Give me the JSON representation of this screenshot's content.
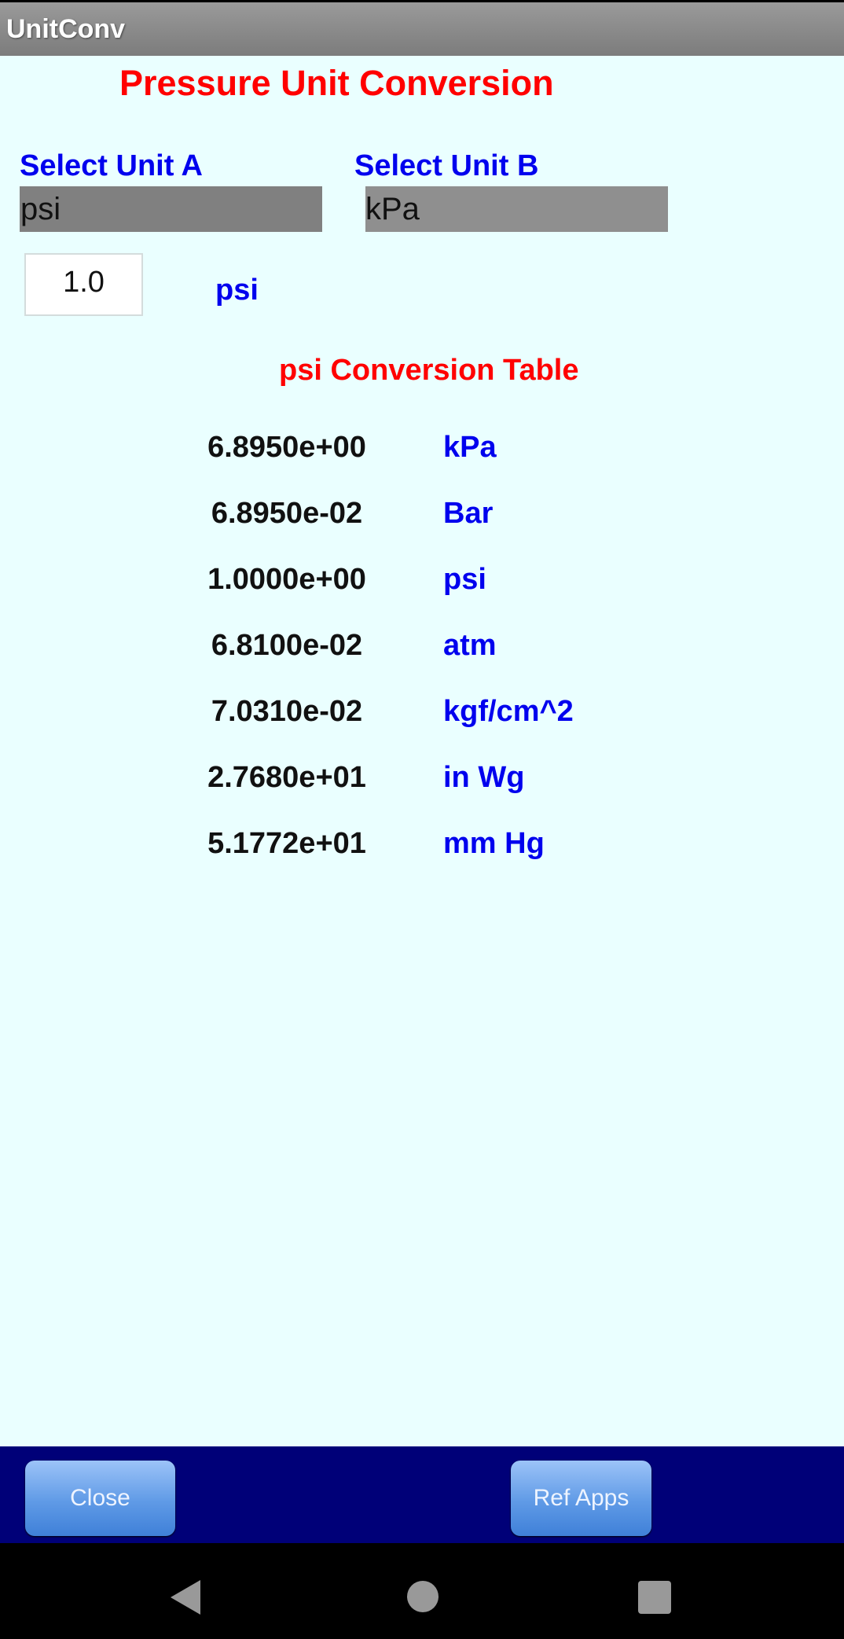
{
  "app": {
    "title": "UnitConv"
  },
  "page": {
    "heading": "Pressure Unit Conversion"
  },
  "unit_a": {
    "label": "Select Unit A",
    "selected": "psi"
  },
  "unit_b": {
    "label": "Select Unit B",
    "selected": "kPa"
  },
  "input": {
    "value": "1.0",
    "unit_label": "psi"
  },
  "table": {
    "title": "psi Conversion Table",
    "rows": [
      {
        "value": "6.8950e+00",
        "unit": "kPa"
      },
      {
        "value": "6.8950e-02",
        "unit": "Bar"
      },
      {
        "value": "1.0000e+00",
        "unit": "psi"
      },
      {
        "value": "6.8100e-02",
        "unit": "atm"
      },
      {
        "value": "7.0310e-02",
        "unit": "kgf/cm^2"
      },
      {
        "value": "2.7680e+01",
        "unit": "in Wg"
      },
      {
        "value": "5.1772e+01",
        "unit": "mm Hg"
      }
    ]
  },
  "buttons": {
    "close": "Close",
    "ref_apps": "Ref Apps"
  },
  "navbar": {
    "icons": [
      "back-icon",
      "home-icon",
      "recents-icon"
    ]
  },
  "colors": {
    "heading": "#ff0000",
    "label": "#0000ee",
    "bottom_bar": "#000078",
    "background": "#eaffff"
  }
}
